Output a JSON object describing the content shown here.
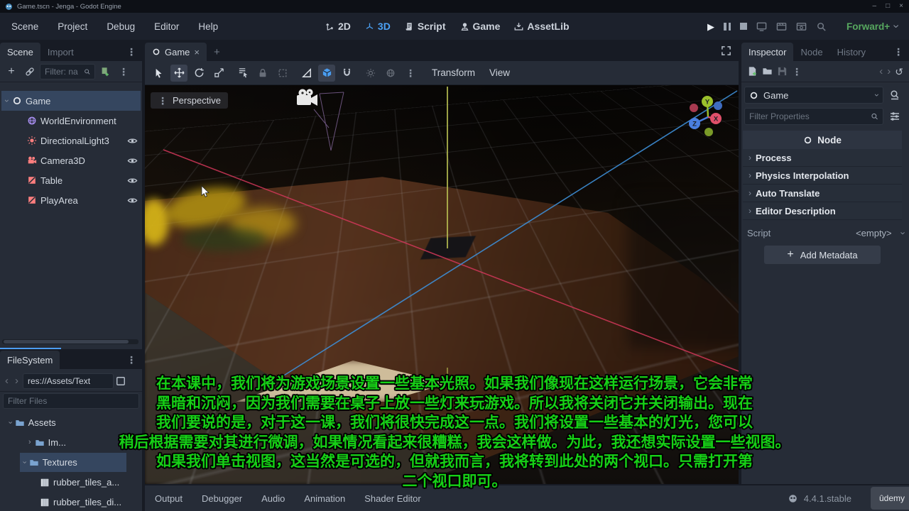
{
  "icons": {
    "vdots": "⋮",
    "chevL": "‹",
    "chevR": "›",
    "close": "×",
    "plus": "+",
    "minus": "–",
    "undo": "↺",
    "play": "▶",
    "maximize": "□"
  },
  "window": {
    "title": "Game.tscn - Jenga - Godot Engine"
  },
  "menubar": {
    "items": [
      "Scene",
      "Project",
      "Debug",
      "Editor",
      "Help"
    ],
    "workspaces": [
      {
        "label": "2D"
      },
      {
        "label": "3D"
      },
      {
        "label": "Script"
      },
      {
        "label": "Game"
      },
      {
        "label": "AssetLib"
      }
    ],
    "renderer": "Forward+"
  },
  "scene_dock": {
    "tabs": [
      "Scene",
      "Import"
    ],
    "filter_placeholder": "Filter: na",
    "tree": [
      {
        "label": "Game"
      },
      {
        "label": "WorldEnvironment"
      },
      {
        "label": "DirectionalLight3"
      },
      {
        "label": "Camera3D"
      },
      {
        "label": "Table"
      },
      {
        "label": "PlayArea"
      }
    ]
  },
  "filesystem_dock": {
    "tab": "FileSystem",
    "path": "res://Assets/Text",
    "filter_placeholder": "Filter Files",
    "tree": [
      {
        "label": "Assets"
      },
      {
        "label": "Im..."
      },
      {
        "label": "Textures"
      },
      {
        "label": "rubber_tiles_a..."
      },
      {
        "label": "rubber_tiles_di..."
      }
    ]
  },
  "viewport": {
    "tab": "Game",
    "perspective_label": "Perspective",
    "menus": [
      "Transform",
      "View"
    ],
    "axis_gizmo": {
      "x": "X",
      "y": "Y",
      "z": "Z"
    }
  },
  "inspector": {
    "tabs": [
      "Inspector",
      "Node",
      "History"
    ],
    "node_name": "Game",
    "filter_placeholder": "Filter Properties",
    "section_header": "Node",
    "categories": [
      "Process",
      "Physics Interpolation",
      "Auto Translate",
      "Editor Description"
    ],
    "script_label": "Script",
    "script_value": "<empty>",
    "add_metadata_label": "Add Metadata"
  },
  "bottom_bar": {
    "tabs": [
      "Output",
      "Debugger",
      "Audio",
      "Animation",
      "Shader Editor"
    ],
    "version": "4.4.1.stable",
    "watermark": "ûdemy"
  },
  "subtitles": {
    "color": "#16d016",
    "lines": [
      "在本课中，我们将为游戏场景设置一些基本光照。如果我们像现在这样运行场景，它会非常",
      "黑暗和沉闷，因为我们需要在桌子上放一些灯来玩游戏。所以我将关闭它并关闭输出。现在",
      "我们要说的是，对于这一课，我们将很快完成这一点。我们将设置一些基本的灯光，您可以",
      "稍后根据需要对其进行微调，如果情况看起来很糟糕，我会这样做。为此，我还想实际设置一些视图。",
      "如果我们单击视图，这当然是可选的，但就我而言，我将转到此处的两个视口。只需打开第",
      "二个视口即可。"
    ]
  },
  "colors": {
    "accent_blue": "#4ba1f5",
    "renderer_green": "#57a85f",
    "node_icon_salmon": "#fc7e7e",
    "subtitle_green": "#16d016",
    "axis_x": "#e0506a",
    "axis_y": "#9bc02c",
    "axis_z": "#4a7fe0"
  }
}
